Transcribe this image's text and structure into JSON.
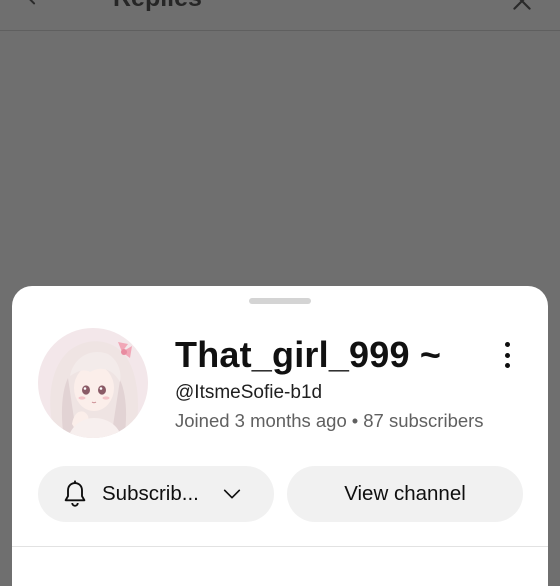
{
  "header": {
    "title": "Replies",
    "back_icon": "arrow-left-icon",
    "close_icon": "close-icon"
  },
  "channel_sheet": {
    "name": "That_girl_999 ~",
    "handle": "@ItsmeSofie-b1d",
    "joined": "Joined 3 months ago",
    "separator": "•",
    "subscribers": "87 subscribers",
    "more_icon": "more-vertical-icon",
    "avatar_icon": "channel-avatar",
    "subscribe": {
      "label": "Subscrib...",
      "icon": "bell-icon",
      "dropdown_icon": "chevron-down-icon"
    },
    "view_channel": {
      "label": "View channel"
    }
  },
  "colors": {
    "scrim": "#6f6f6f",
    "sheet": "#ffffff",
    "pill": "#f1f1f1",
    "text_primary": "#0f0f0f",
    "text_secondary": "#606060"
  }
}
